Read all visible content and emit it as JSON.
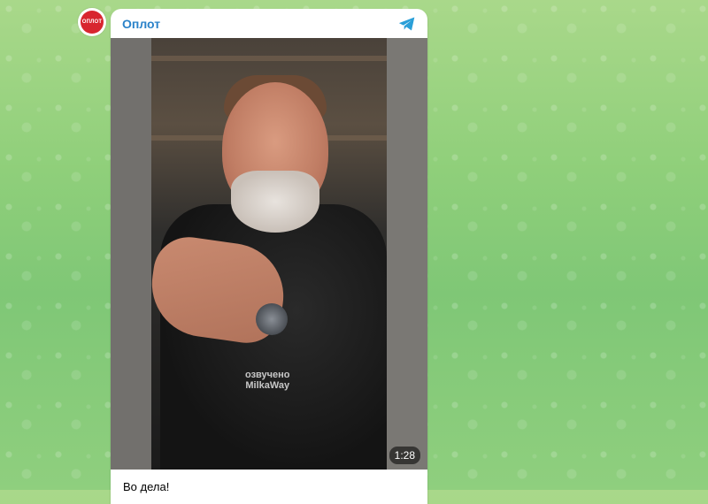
{
  "channel": {
    "name": "Оплот",
    "avatar_text": "ОПЛОТ"
  },
  "video": {
    "duration": "1:28",
    "watermark_line1": "озвучено",
    "watermark_line2": "MilkaWay"
  },
  "post": {
    "caption": "Во дела!"
  },
  "colors": {
    "accent": "#2a82c9",
    "avatar_bg": "#d8262f"
  },
  "icons": {
    "share": "telegram-plane-icon"
  }
}
